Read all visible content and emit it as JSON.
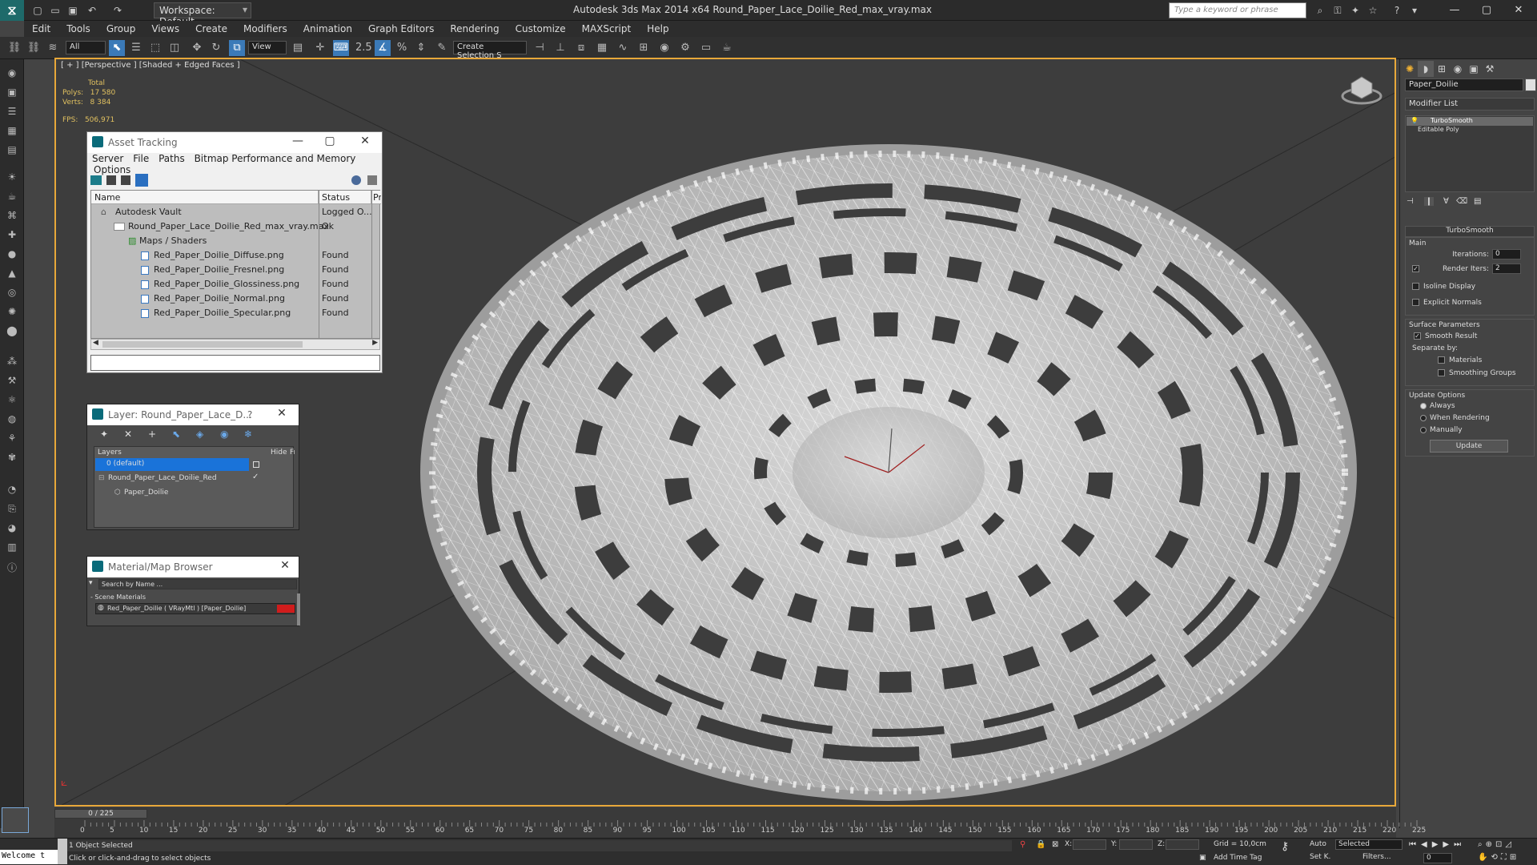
{
  "app": {
    "title": "Autodesk 3ds Max  2014 x64    Round_Paper_Lace_Doilie_Red_max_vray.max",
    "workspace_label": "Workspace: Default",
    "search_placeholder": "Type a keyword or phrase"
  },
  "menu": [
    "Edit",
    "Tools",
    "Group",
    "Views",
    "Create",
    "Modifiers",
    "Animation",
    "Graph Editors",
    "Rendering",
    "Customize",
    "MAXScript",
    "Help"
  ],
  "toolbar": {
    "selection_filter": "All",
    "ref_coord": "View",
    "named_selection": "Create Selection S"
  },
  "viewport": {
    "label": "[ + ] [Perspective ] [Shaded + Edged Faces ]",
    "stats_header": "Total",
    "polys_label": "Polys:",
    "polys_value": "17 580",
    "verts_label": "Verts:",
    "verts_value": "8 384",
    "fps_label": "FPS:",
    "fps_value": "506,971"
  },
  "asset_tracking": {
    "title": "Asset Tracking",
    "menu": [
      "Server",
      "File",
      "Paths",
      "Bitmap Performance and Memory",
      "Options"
    ],
    "col_name": "Name",
    "col_status": "Status",
    "col_pr": "Pr",
    "rows": [
      {
        "name": "Autodesk Vault",
        "status": "Logged O..."
      },
      {
        "name": "Round_Paper_Lace_Doilie_Red_max_vray.max",
        "status": "Ok"
      },
      {
        "name": "Maps / Shaders",
        "status": ""
      },
      {
        "name": "Red_Paper_Doilie_Diffuse.png",
        "status": "Found"
      },
      {
        "name": "Red_Paper_Doilie_Fresnel.png",
        "status": "Found"
      },
      {
        "name": "Red_Paper_Doilie_Glossiness.png",
        "status": "Found"
      },
      {
        "name": "Red_Paper_Doilie_Normal.png",
        "status": "Found"
      },
      {
        "name": "Red_Paper_Doilie_Specular.png",
        "status": "Found"
      }
    ]
  },
  "layer_panel": {
    "title": "Layer: Round_Paper_Lace_D...",
    "help": "?",
    "col_layers": "Layers",
    "col_hide": "Hide",
    "col_fr": "Fr",
    "rows": [
      {
        "name": "0 (default)"
      },
      {
        "name": "Round_Paper_Lace_Doilie_Red"
      },
      {
        "name": "Paper_Doilie"
      }
    ]
  },
  "material_browser": {
    "title": "Material/Map Browser",
    "search_placeholder": "Search by Name ...",
    "section": "- Scene Materials",
    "item": "Red_Paper_Doilie  ( VRayMtl ) [Paper_Doilie]"
  },
  "command_panel": {
    "object_name": "Paper_Doilie",
    "modifier_list": "Modifier List",
    "stack": [
      "TurboSmooth",
      "Editable Poly"
    ],
    "rollout_title": "TurboSmooth",
    "main_label": "Main",
    "iterations_label": "Iterations:",
    "iterations_value": "0",
    "render_iters_label": "Render Iters:",
    "render_iters_value": "2",
    "isoline_label": "Isoline Display",
    "explicit_normals_label": "Explicit Normals",
    "surface_params_label": "Surface Parameters",
    "smooth_result_label": "Smooth Result",
    "separate_by_label": "Separate by:",
    "materials_label": "Materials",
    "smoothing_groups_label": "Smoothing Groups",
    "update_options_label": "Update Options",
    "always_label": "Always",
    "when_rendering_label": "When Rendering",
    "manually_label": "Manually",
    "update_button": "Update"
  },
  "timeline": {
    "frame_counter": "0 / 225",
    "ticks": [
      "0",
      "5",
      "10",
      "15",
      "20",
      "25",
      "30",
      "35",
      "40",
      "45",
      "50",
      "55",
      "60",
      "65",
      "70",
      "75",
      "80",
      "85",
      "90",
      "95",
      "100",
      "105",
      "110",
      "115",
      "120",
      "125",
      "130",
      "135",
      "140",
      "145",
      "150",
      "155",
      "160",
      "165",
      "170",
      "175",
      "180",
      "185",
      "190",
      "195",
      "200",
      "205",
      "210",
      "215",
      "220",
      "225"
    ]
  },
  "status": {
    "maxscript": "Welcome t",
    "selection_info": "1 Object Selected",
    "prompt": "Click or click-and-drag to select objects",
    "x_label": "X:",
    "y_label": "Y:",
    "z_label": "Z:",
    "grid": "Grid = 10,0cm",
    "add_time_tag": "Add Time Tag",
    "auto_key": "Auto",
    "set_key": "Set K.",
    "key_filter": "Selected",
    "filters": "Filters...",
    "frame_field": "0"
  }
}
